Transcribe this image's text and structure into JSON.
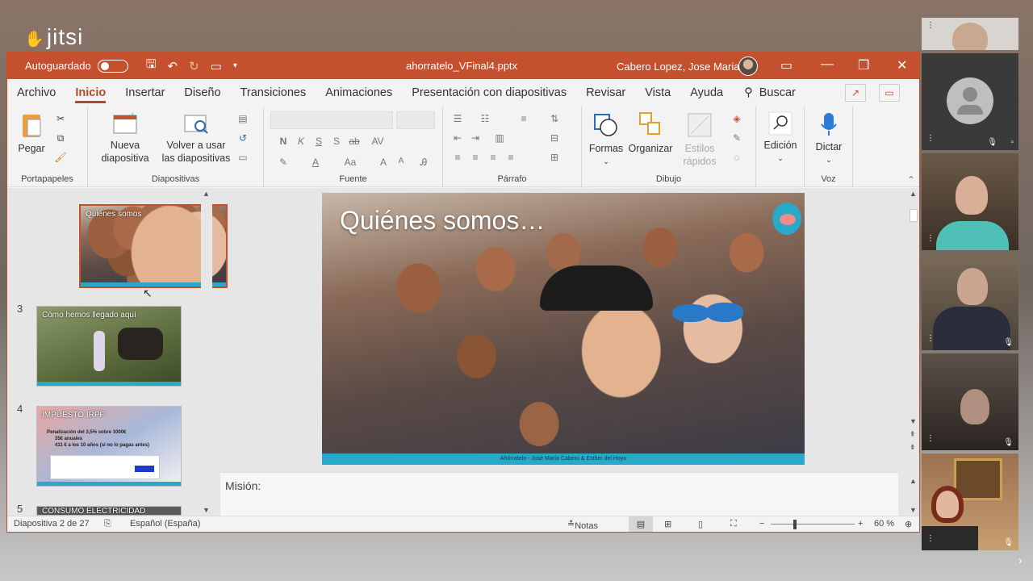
{
  "jitsi": {
    "logo": "jitsi"
  },
  "titlebar": {
    "autosave_label": "Autoguardado",
    "filename": "ahorratelo_VFinal4.pptx",
    "user_name": "Cabero Lopez, Jose Maria"
  },
  "menu": {
    "tabs": [
      "Archivo",
      "Inicio",
      "Insertar",
      "Diseño",
      "Transiciones",
      "Animaciones",
      "Presentación con diapositivas",
      "Revisar",
      "Vista",
      "Ayuda"
    ],
    "active_tab": "Inicio",
    "search_label": "Buscar"
  },
  "ribbon": {
    "paste": "Pegar",
    "new_slide": "Nueva diapositiva",
    "reuse_slides": "Volver a usar las diapositivas",
    "shapes": "Formas",
    "arrange": "Organizar",
    "quick_styles": "Estilos rápidos",
    "editing": "Edición",
    "dictate": "Dictar",
    "groups": {
      "clipboard": "Portapapeles",
      "slides": "Diapositivas",
      "font": "Fuente",
      "paragraph": "Párrafo",
      "drawing": "Dibujo",
      "voice": "Voz"
    },
    "font_buttons": [
      "N",
      "K",
      "S",
      "S",
      "AV"
    ],
    "font_size_buttons": [
      "Aa",
      "A",
      "A"
    ]
  },
  "thumbnails": [
    {
      "number": "",
      "title": "Quiénes somos",
      "selected": true
    },
    {
      "number": "3",
      "title": "Cómo hemos llegado aquí",
      "selected": false
    },
    {
      "number": "4",
      "title": "IMPUESTO IRPF",
      "selected": false
    },
    {
      "number": "5",
      "title": "CONSUMO ELECTRICIDAD",
      "selected": false
    }
  ],
  "thumb4_lines": [
    "Penalización del 3,5% sobre 1000€",
    "35€ anuales",
    "411 € a los 10 años (si no lo pagas antes)"
  ],
  "slide": {
    "title": "Quiénes somos…",
    "footer": "Ahórratelo - José María Cabero & Esther del Hoyo"
  },
  "notes": {
    "label": "Misión:"
  },
  "status": {
    "slide_counter": "Diapositiva 2 de 27",
    "language": "Español (España)",
    "notes_button": "Notas",
    "zoom": "60 %"
  },
  "colors": {
    "ppt_accent": "#c4502e",
    "slide_footer": "#29a8c9"
  }
}
